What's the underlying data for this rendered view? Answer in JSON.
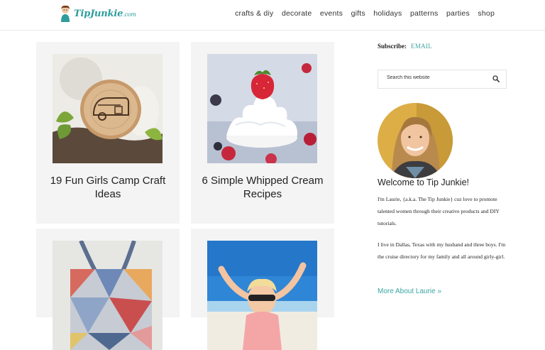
{
  "header": {
    "logo_text": "TipJunkie",
    "logo_suffix": ".com",
    "nav": [
      {
        "label": "crafts & diy"
      },
      {
        "label": "decorate"
      },
      {
        "label": "events"
      },
      {
        "label": "gifts"
      },
      {
        "label": "holidays"
      },
      {
        "label": "patterns"
      },
      {
        "label": "parties"
      },
      {
        "label": "shop"
      }
    ]
  },
  "posts": [
    {
      "title": "19 Fun Girls Camp Craft Ideas"
    },
    {
      "title": "6 Simple Whipped Cream Recipes"
    },
    {
      "title": ""
    },
    {
      "title": ""
    }
  ],
  "sidebar": {
    "subscribe_label": "Subscribe:",
    "subscribe_link": "EMAIL",
    "search_placeholder": "Search this website",
    "welcome": "Welcome to Tip Junkie!",
    "bio1": "I'm Laurie, {a.k.a. The Tip Junkie} cuz love to promote talented women through their creative products and DIY tutorials.",
    "bio2": "I live in Dallas, Texas with my husband and three boys. I'm the cruise directory for my family and all around girly-girl.",
    "more_link": "More About Laurie »"
  },
  "colors": {
    "accent": "#3aa6a0",
    "card_bg": "#f4f4f4",
    "text": "#222222"
  }
}
